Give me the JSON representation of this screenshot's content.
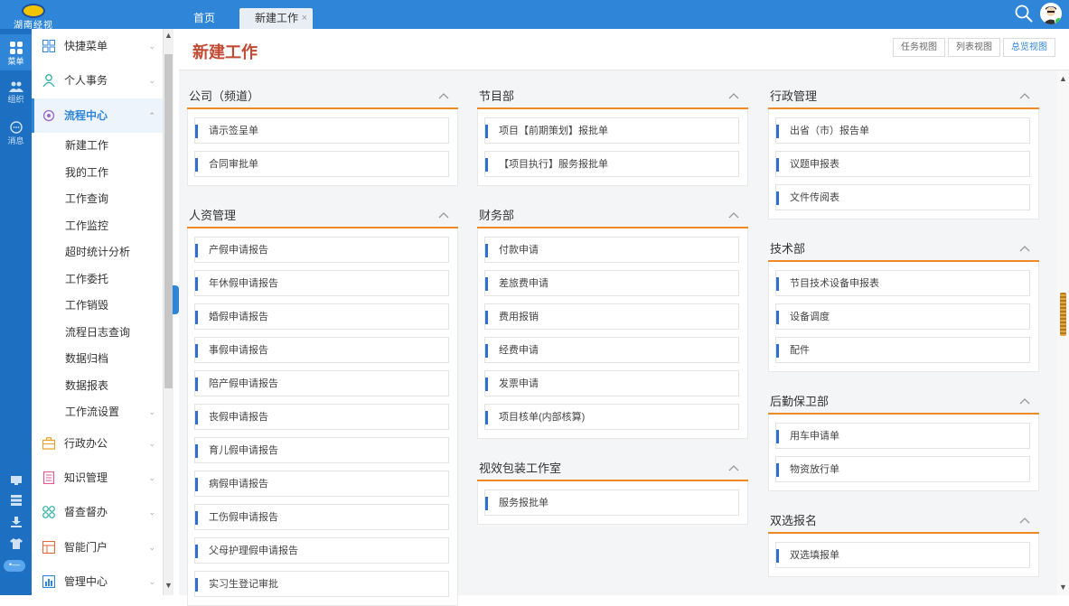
{
  "app": {
    "logo_text": "湖南经视"
  },
  "tabs": [
    {
      "label": "首页"
    },
    {
      "label": "新建工作",
      "close": "×"
    }
  ],
  "rail": {
    "items": [
      {
        "label": "菜单",
        "icon": "grid-icon"
      },
      {
        "label": "组织",
        "icon": "people-icon"
      },
      {
        "label": "消息",
        "icon": "chat-icon"
      }
    ],
    "bottom_icons": [
      "monitor-icon",
      "server-icon",
      "download-icon",
      "shirt-icon",
      "toggle-icon"
    ],
    "pill": "•—"
  },
  "menu": {
    "groups": [
      {
        "label": "快捷菜单",
        "icon": "quick-menu-icon",
        "chev": "⌄"
      },
      {
        "label": "个人事务",
        "icon": "person-icon",
        "chev": "⌄"
      },
      {
        "label": "流程中心",
        "icon": "flow-icon",
        "chev": "⌃"
      }
    ],
    "sub_items": [
      {
        "label": "新建工作"
      },
      {
        "label": "我的工作"
      },
      {
        "label": "工作查询"
      },
      {
        "label": "工作监控"
      },
      {
        "label": "超时统计分析"
      },
      {
        "label": "工作委托"
      },
      {
        "label": "工作销毁"
      },
      {
        "label": "流程日志查询"
      },
      {
        "label": "数据归档"
      },
      {
        "label": "数据报表"
      },
      {
        "label": "工作流设置",
        "chev": "⌄"
      }
    ],
    "groups_after": [
      {
        "label": "行政办公",
        "icon": "briefcase-icon",
        "chev": "⌄"
      },
      {
        "label": "知识管理",
        "icon": "book-icon",
        "chev": "⌄"
      },
      {
        "label": "督查督办",
        "icon": "apps-icon",
        "chev": "⌄"
      },
      {
        "label": "智能门户",
        "icon": "portal-icon",
        "chev": "⌄"
      },
      {
        "label": "管理中心",
        "icon": "chart-icon",
        "chev": "⌄"
      }
    ]
  },
  "main": {
    "title": "新建工作",
    "view_buttons": [
      {
        "label": "任务视图"
      },
      {
        "label": "列表视图"
      },
      {
        "label": "总览视图",
        "active": true
      }
    ]
  },
  "columns": [
    [
      {
        "title": "公司（频道）",
        "items": [
          "请示签呈单",
          "合同审批单"
        ]
      },
      {
        "title": "人资管理",
        "items": [
          "产假申请报告",
          "年休假申请报告",
          "婚假申请报告",
          "事假申请报告",
          "陪产假申请报告",
          "丧假申请报告",
          "育儿假申请报告",
          "病假申请报告",
          "工伤假申请报告",
          "父母护理假申请报告",
          "实习生登记审批"
        ]
      }
    ],
    [
      {
        "title": "节目部",
        "items": [
          "项目【前期策划】报批单",
          "【项目执行】服务报批单"
        ]
      },
      {
        "title": "财务部",
        "items": [
          "付款申请",
          "差旅费申请",
          "费用报销",
          "经费申请",
          "发票申请",
          "项目核单(内部核算)"
        ]
      },
      {
        "title": "视效包装工作室",
        "items": [
          "服务报批单"
        ]
      }
    ],
    [
      {
        "title": "行政管理",
        "items": [
          "出省（市）报告单",
          "议题申报表",
          "文件传阅表"
        ]
      },
      {
        "title": "技术部",
        "items": [
          "节目技术设备申报表",
          "设备调度",
          "配件"
        ]
      },
      {
        "title": "后勤保卫部",
        "items": [
          "用车申请单",
          "物资放行单"
        ]
      },
      {
        "title": "双选报名",
        "items": [
          "双选填报单"
        ]
      }
    ]
  ],
  "colors": {
    "brand_blue": "#2f86d8",
    "rail_blue": "#1d6fc2",
    "accent_orange": "#f08a24",
    "title_red": "#c34a32"
  }
}
